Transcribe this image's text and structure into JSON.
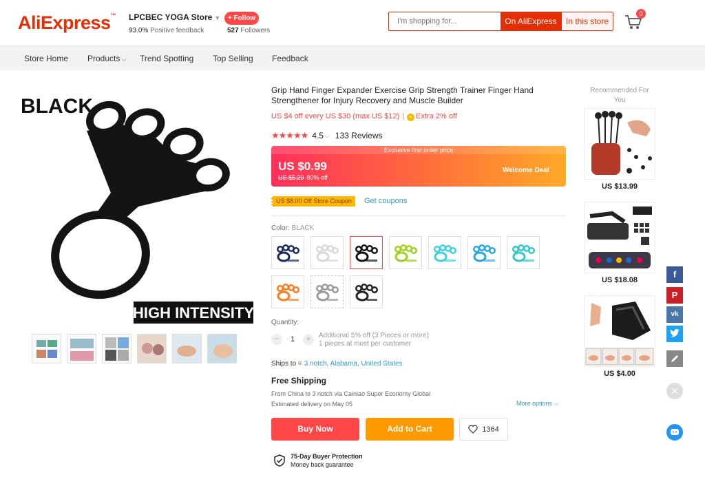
{
  "header": {
    "logo": "AliExpress",
    "store_name": "LPCBEC YOGA Store",
    "positive_feedback_value": "93.0%",
    "positive_feedback_label": "Positive feedback",
    "follow_label": "+ Follow",
    "followers_count": "527",
    "followers_label": "Followers",
    "search_placeholder": "I'm shopping for...",
    "search_on_ali": "On AliExpress",
    "search_in_store": "In this store",
    "cart_count": "0"
  },
  "nav": {
    "store_home": "Store Home",
    "products": "Products",
    "trend": "Trend Spotting",
    "top_selling": "Top Selling",
    "feedback": "Feedback"
  },
  "gallery": {
    "overlay_top": "BLACK",
    "overlay_bottom": "HIGH INTENSITY"
  },
  "product": {
    "title": "Grip Hand Finger Expander Exercise Grip Strength Trainer Finger Hand Strengthener for Injury Recovery and Muscle Builder",
    "promo_store": "US $4 off every US $30 (max US $12)",
    "promo_extra": "Extra 2% off",
    "rating_value": "4.5",
    "reviews": "133 Reviews",
    "price_banner": "Exclusive first order price",
    "price_now": "US $0.99",
    "price_old": "US $5.20",
    "discount": "80% off",
    "welcome_deal": "Welcome Deal",
    "coupon": "US $8.00 Off Store Coupon",
    "get_coupons": "Get coupons",
    "color_label": "Color:",
    "color_value": "BLACK",
    "quantity_label": "Quantity:",
    "quantity_value": "1",
    "qty_info_1": "Additional 5% off (3 Pieces or more)",
    "qty_info_2": "1 pieces at most per customer",
    "ships_to": "Ships to",
    "ships_location": "3 notch, Alabama, United States",
    "free_shipping": "Free Shipping",
    "ship_route": "From China to 3 notch via Cainiao Super Economy Global",
    "delivery": "Estimated delivery on May 05",
    "more_options": "More options",
    "buy_now": "Buy Now",
    "add_to_cart": "Add to Cart",
    "wishlist_count": "1364",
    "protection_title": "75-Day Buyer Protection",
    "protection_sub": "Money back guarantee"
  },
  "recommended": {
    "title": "Recommended For You",
    "items": [
      {
        "price": "US $13.99"
      },
      {
        "price": "US $18.08"
      },
      {
        "price": "US $4.00"
      }
    ]
  },
  "colors": {
    "brand": "#e62e04",
    "accent": "#ff4747",
    "link": "#2e9cc3",
    "cart_btn": "#ff9a00"
  },
  "swatches": [
    {
      "color": "#1a2a5a",
      "label": "navy"
    },
    {
      "color": "#d8d8d8",
      "label": "white"
    },
    {
      "color": "#111111",
      "label": "black",
      "selected": true
    },
    {
      "color": "#9bd21a",
      "label": "green"
    },
    {
      "color": "#3cd0e0",
      "label": "cyan"
    },
    {
      "color": "#28a8e0",
      "label": "blue"
    },
    {
      "color": "#30c8c8",
      "label": "teal"
    },
    {
      "color": "#ff7a1a",
      "label": "orange"
    },
    {
      "color": "#9a9a9a",
      "label": "gray"
    },
    {
      "color": "#222222",
      "label": "black-set"
    }
  ]
}
